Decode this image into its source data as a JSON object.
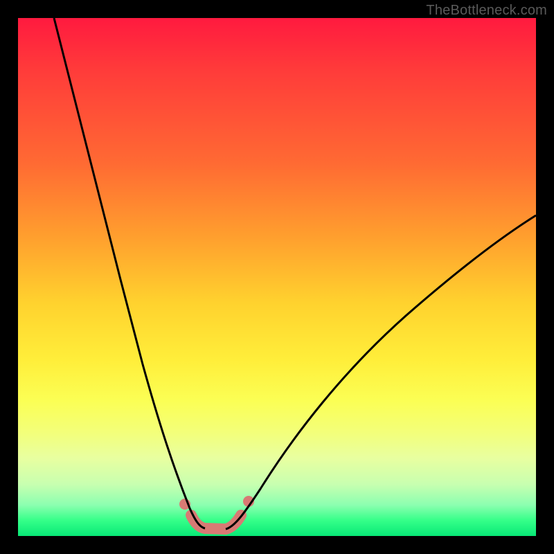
{
  "watermark": "TheBottleneck.com",
  "chart_data": {
    "type": "line",
    "title": "",
    "xlabel": "",
    "ylabel": "",
    "xlim": [
      0,
      100
    ],
    "ylim": [
      0,
      100
    ],
    "grid": false,
    "legend": false,
    "background": {
      "direction": "vertical",
      "stops": [
        {
          "pos": 0.0,
          "color": "#ff1a3f"
        },
        {
          "pos": 0.28,
          "color": "#ff6a33"
        },
        {
          "pos": 0.55,
          "color": "#ffd22e"
        },
        {
          "pos": 0.8,
          "color": "#f3ff7a"
        },
        {
          "pos": 0.97,
          "color": "#35ff89"
        },
        {
          "pos": 1.0,
          "color": "#08e876"
        }
      ]
    },
    "series": [
      {
        "name": "curve-left",
        "stroke": "#000000",
        "stroke_width": 3,
        "x": [
          7,
          10,
          13,
          16,
          19,
          22,
          25,
          27,
          29,
          30.5,
          32,
          33.5,
          35,
          36
        ],
        "y": [
          100,
          86,
          72,
          59,
          47,
          36,
          26,
          20,
          14,
          10,
          7,
          4.5,
          2.5,
          1.5
        ]
      },
      {
        "name": "curve-right",
        "stroke": "#000000",
        "stroke_width": 3,
        "x": [
          40,
          42,
          45,
          49,
          54,
          60,
          67,
          75,
          84,
          94,
          100
        ],
        "y": [
          1.5,
          3,
          6.5,
          12,
          19,
          27,
          35,
          43,
          51,
          58,
          62
        ]
      },
      {
        "name": "trough-band",
        "stroke": "#d87a74",
        "stroke_width": 16,
        "linecap": "round",
        "x": [
          33.5,
          34.5,
          36,
          38,
          40,
          41.5,
          43
        ],
        "y": [
          4.0,
          2.2,
          1.4,
          1.2,
          1.4,
          2.2,
          4.0
        ]
      },
      {
        "name": "trough-dots",
        "type": "scatter",
        "fill": "#d87a74",
        "r": 8,
        "x": [
          32.3,
          44.5
        ],
        "y": [
          6.2,
          6.8
        ]
      }
    ]
  }
}
